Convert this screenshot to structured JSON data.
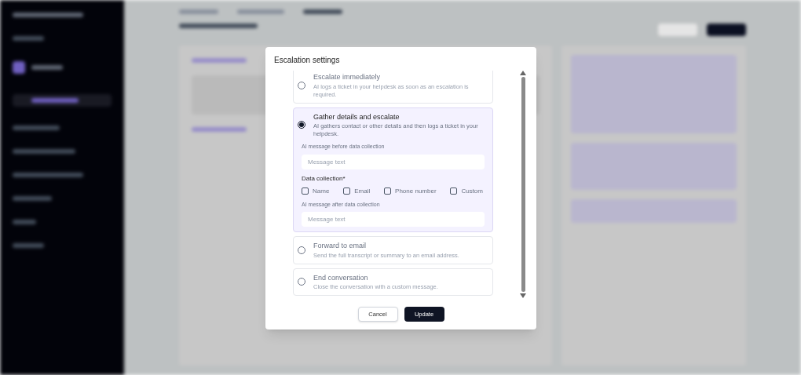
{
  "dialog": {
    "title": "Escalation settings",
    "options": [
      {
        "title": "Escalate immediately",
        "description": "AI logs a ticket in your helpdesk as soon as an escalation is required.",
        "selected": false
      },
      {
        "title": "Gather details and escalate",
        "description": "AI gathers contact or other details and then logs a ticket in your helpdesk.",
        "selected": true,
        "before_label": "AI message before data collection",
        "before_placeholder": "Message text",
        "collection_label": "Data collection*",
        "fields": [
          {
            "label": "Name",
            "checked": false
          },
          {
            "label": "Email",
            "checked": false
          },
          {
            "label": "Phone number",
            "checked": false
          },
          {
            "label": "Custom",
            "checked": false
          }
        ],
        "after_label": "AI message after data collection",
        "after_placeholder": "Message text"
      },
      {
        "title": "Forward to email",
        "description": "Send the full transcript or summary to an email address.",
        "selected": false
      },
      {
        "title": "End conversation",
        "description": "Close the conversation with a custom message.",
        "selected": false
      }
    ],
    "buttons": [
      {
        "label": "Cancel",
        "kind": "secondary"
      },
      {
        "label": "Update",
        "kind": "primary"
      }
    ]
  }
}
